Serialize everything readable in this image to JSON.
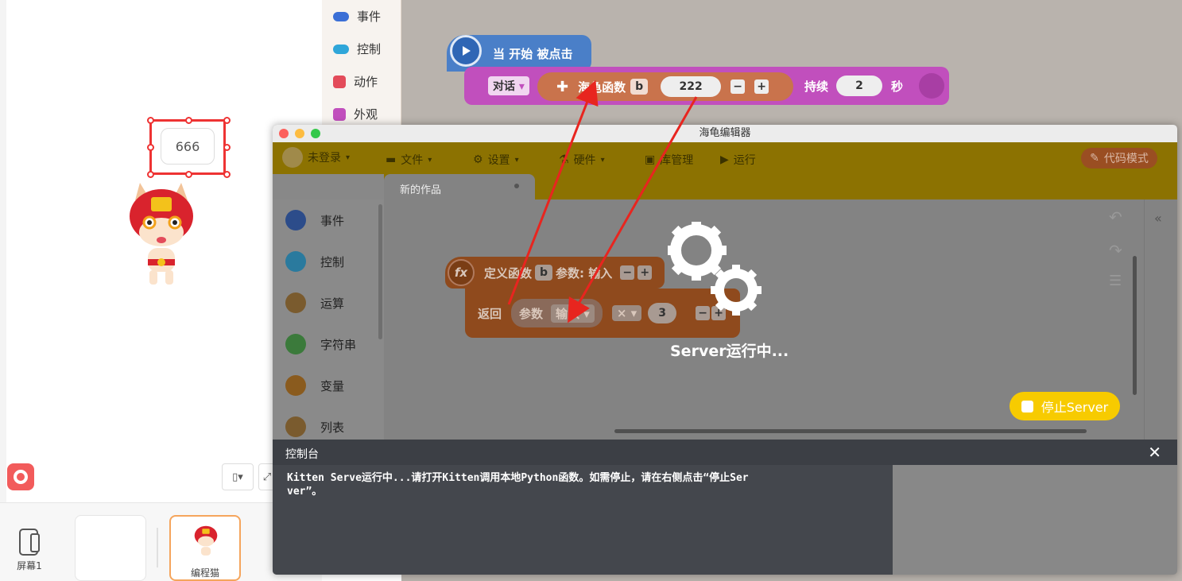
{
  "stage": {
    "speech_text": "666",
    "screen_label": "屏幕1",
    "sprite_label": "编程猫"
  },
  "bg_categories": [
    {
      "label": "事件",
      "color": "#3b6fd6"
    },
    {
      "label": "控制",
      "color": "#2fa6d9"
    },
    {
      "label": "动作",
      "color": "#e34b5a"
    },
    {
      "label": "外观",
      "color": "#c14fbd"
    }
  ],
  "bg_blocks": {
    "hat_label": "当 开始 被点击",
    "say_label": "对话",
    "func_label": "海龟函数",
    "func_param": "b",
    "func_value": "222",
    "duration_label": "持续",
    "duration_value": "2",
    "seconds_label": "秒"
  },
  "editor": {
    "title": "海龟编辑器",
    "toolbar": {
      "login": "未登录",
      "file": "文件",
      "settings": "设置",
      "hardware": "硬件",
      "library": "库管理",
      "run": "运行",
      "code_mode": "代码模式"
    },
    "tab_title": "新的作品",
    "categories": [
      {
        "label": "事件",
        "color": "#2c4c8a"
      },
      {
        "label": "控制",
        "color": "#2a7a9e"
      },
      {
        "label": "运算",
        "color": "#7a5b2e"
      },
      {
        "label": "字符串",
        "color": "#3b7a3b"
      },
      {
        "label": "变量",
        "color": "#8a5b1e"
      },
      {
        "label": "列表",
        "color": "#7a5b2e"
      }
    ],
    "def_block": {
      "label": "定义函数",
      "param": "b",
      "args_label": "参数: 输入"
    },
    "return_block": {
      "label": "返回",
      "param_label": "参数",
      "input_label": "输入",
      "op": "×",
      "value": "3"
    },
    "server_text": "Server运行中...",
    "stop_button": "停止Server",
    "console_title": "控制台",
    "console_line1": "Kitten Serve运行中...请打开Kitten调用本地Python函数。如需停止，请在右侧点击“停止Ser",
    "console_line2": "ver”。"
  }
}
